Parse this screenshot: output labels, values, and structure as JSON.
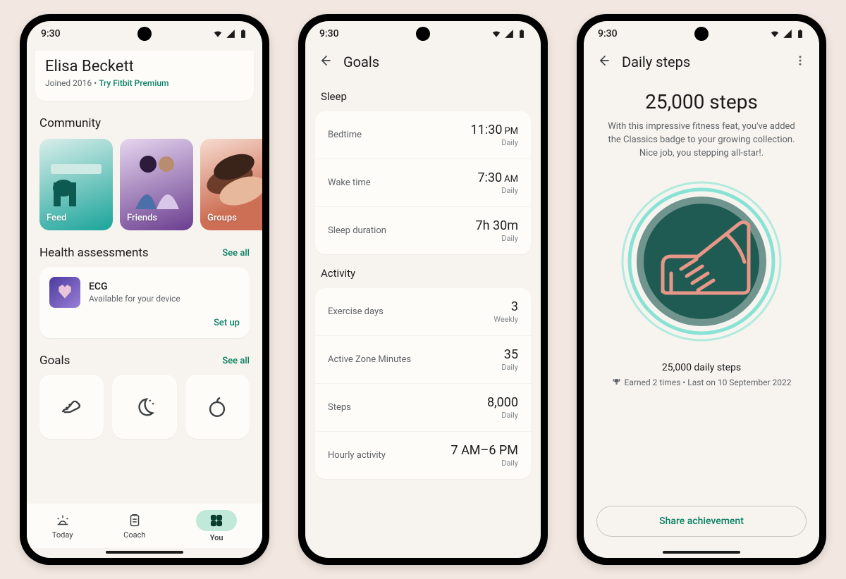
{
  "statusbar": {
    "time": "9:30"
  },
  "screen1": {
    "profile": {
      "name": "Elisa Beckett",
      "joined": "Joined 2016",
      "premium_cta": "Try Fitbit Premium"
    },
    "community": {
      "title": "Community",
      "items": [
        {
          "label": "Feed"
        },
        {
          "label": "Friends"
        },
        {
          "label": "Groups"
        }
      ]
    },
    "health": {
      "title": "Health assessments",
      "see_all": "See all",
      "card": {
        "title": "ECG",
        "subtitle": "Available for your device",
        "cta": "Set up"
      }
    },
    "goals": {
      "title": "Goals",
      "see_all": "See all"
    },
    "nav": {
      "today": "Today",
      "coach": "Coach",
      "you": "You"
    }
  },
  "screen2": {
    "title": "Goals",
    "sleep": {
      "title": "Sleep",
      "rows": [
        {
          "label": "Bedtime",
          "value": "11:30",
          "suffix": "PM",
          "freq": "Daily"
        },
        {
          "label": "Wake time",
          "value": "7:30",
          "suffix": "AM",
          "freq": "Daily"
        },
        {
          "label": "Sleep duration",
          "value": "7h 30m",
          "suffix": "",
          "freq": "Daily"
        }
      ]
    },
    "activity": {
      "title": "Activity",
      "rows": [
        {
          "label": "Exercise days",
          "value": "3",
          "suffix": "",
          "freq": "Weekly"
        },
        {
          "label": "Active Zone Minutes",
          "value": "35",
          "suffix": "",
          "freq": "Daily"
        },
        {
          "label": "Steps",
          "value": "8,000",
          "suffix": "",
          "freq": "Daily"
        },
        {
          "label": "Hourly activity",
          "value": "7 AM–6 PM",
          "suffix": "",
          "freq": "Daily"
        }
      ]
    }
  },
  "screen3": {
    "title": "Daily steps",
    "headline": "25,000 steps",
    "description": "With this impressive fitness feat, you've added the Classics badge to your growing collection. Nice job, you stepping all-star!.",
    "subtitle": "25,000 daily steps",
    "earned": "Earned 2 times • Last on 10 September 2022",
    "share": "Share achievement"
  }
}
